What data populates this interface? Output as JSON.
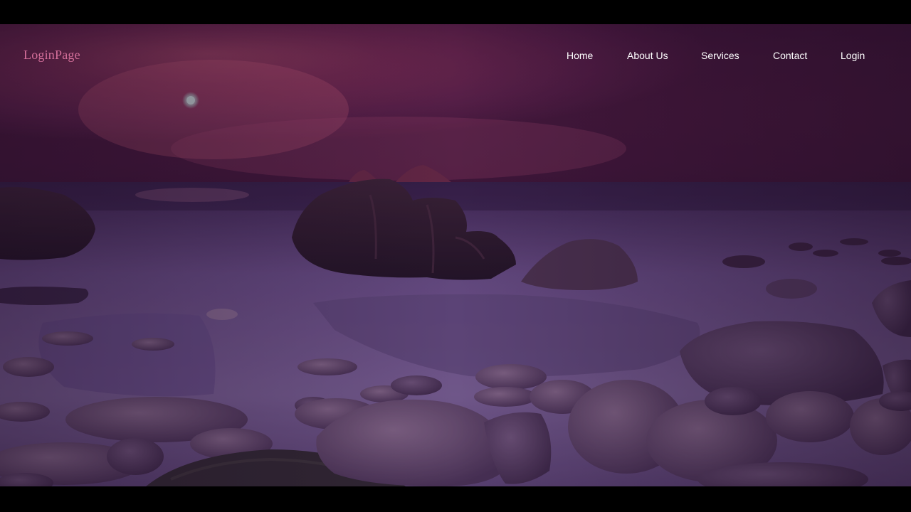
{
  "navbar": {
    "logo": "LoginPage",
    "links": [
      {
        "label": "Home"
      },
      {
        "label": "About Us"
      },
      {
        "label": "Services"
      },
      {
        "label": "Contact"
      },
      {
        "label": "Login"
      }
    ]
  },
  "hero": {
    "background": "beach-rocks-sunset-image"
  },
  "colors": {
    "logo": "#d46f9a",
    "nav_text": "#ffffff",
    "letterbox": "#000000",
    "overlay": "#3a1448"
  }
}
